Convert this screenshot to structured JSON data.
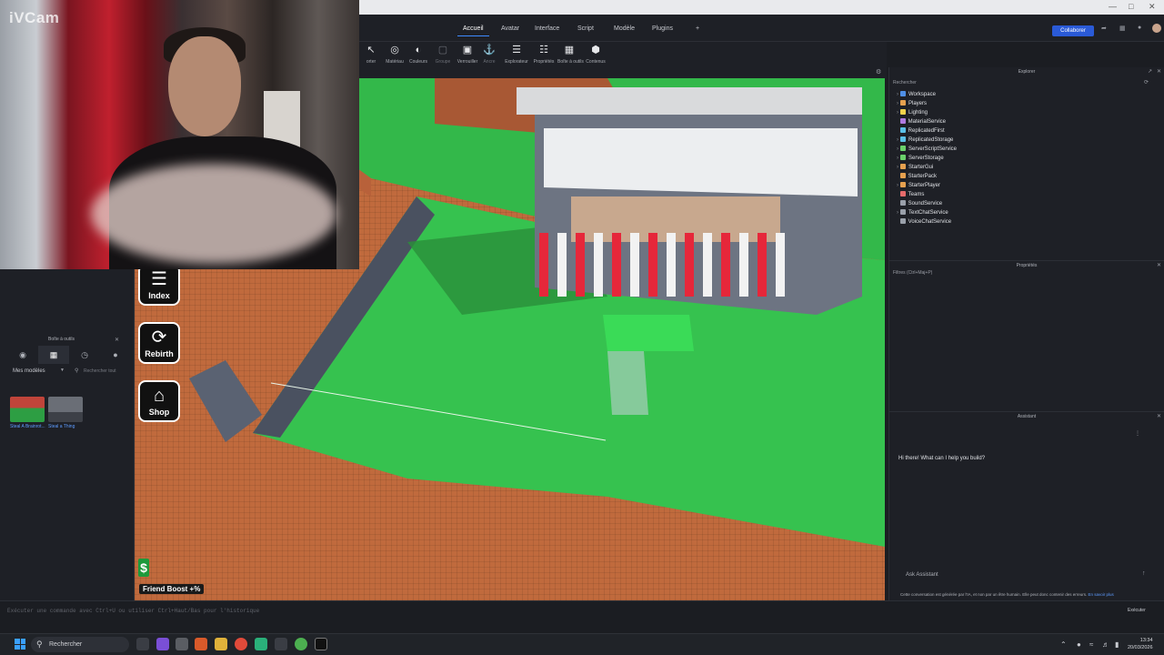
{
  "webcam": {
    "watermark": "iVCam"
  },
  "menu": {
    "tabs": [
      "Accueil",
      "Avatar",
      "Interface",
      "Script",
      "Modèle",
      "Plugins"
    ],
    "active": "Accueil",
    "collaborate": "Collaborer"
  },
  "toolbar": {
    "items": [
      {
        "icon": "mouse",
        "label": "orter",
        "dim": false
      },
      {
        "icon": "material",
        "label": "Matériau",
        "dim": false
      },
      {
        "icon": "color",
        "label": "Couleurs",
        "dim": false
      },
      {
        "icon": "group",
        "label": "Groupe",
        "dim": true
      },
      {
        "icon": "lock",
        "label": "Verrouiller",
        "dim": false
      },
      {
        "icon": "anchor",
        "label": "Ancre",
        "dim": true
      },
      {
        "icon": "explorer",
        "label": "Explorateur",
        "dim": false
      },
      {
        "icon": "properties",
        "label": "Propriétés",
        "dim": false
      },
      {
        "icon": "toolbox",
        "label": "Boîte à outils",
        "dim": false
      },
      {
        "icon": "content",
        "label": "Contenus",
        "dim": false
      }
    ]
  },
  "game_hud": {
    "index_label": "Index",
    "rebirth_label": "Rebirth",
    "shop_label": "Shop",
    "friend_boost": "Friend Boost +%",
    "dollar": "$"
  },
  "toolbox": {
    "title": "Boîte à outils",
    "dropdown": "Mes modèles",
    "search_placeholder": "Rechercher tout",
    "models": [
      {
        "name": "Steal A Brainrot...",
        "color": "#8a3a2e"
      },
      {
        "name": "Steal a Thing",
        "color": "#5a5d63"
      }
    ]
  },
  "explorer": {
    "title": "Explorer",
    "search_placeholder": "Rechercher",
    "items": [
      {
        "name": "Workspace",
        "color": "#4f8fe6",
        "expandable": true
      },
      {
        "name": "Players",
        "color": "#e6a14f",
        "expandable": true
      },
      {
        "name": "Lighting",
        "color": "#f2d24b",
        "expandable": true
      },
      {
        "name": "MaterialService",
        "color": "#b07be0",
        "expandable": false
      },
      {
        "name": "ReplicatedFirst",
        "color": "#5bc0e6",
        "expandable": false
      },
      {
        "name": "ReplicatedStorage",
        "color": "#5bc0e6",
        "expandable": true
      },
      {
        "name": "ServerScriptService",
        "color": "#6bd26b",
        "expandable": true
      },
      {
        "name": "ServerStorage",
        "color": "#6bd26b",
        "expandable": true
      },
      {
        "name": "StarterGui",
        "color": "#e6a14f",
        "expandable": true
      },
      {
        "name": "StarterPack",
        "color": "#e6a14f",
        "expandable": false
      },
      {
        "name": "StarterPlayer",
        "color": "#e6a14f",
        "expandable": true
      },
      {
        "name": "Teams",
        "color": "#e66b6b",
        "expandable": false
      },
      {
        "name": "SoundService",
        "color": "#9aa0aa",
        "expandable": false
      },
      {
        "name": "TextChatService",
        "color": "#9aa0aa",
        "expandable": true
      },
      {
        "name": "VoiceChatService",
        "color": "#9aa0aa",
        "expandable": false
      }
    ]
  },
  "properties": {
    "title": "Propriétés",
    "filter_placeholder": "Filtres (Ctrl+Maj+P)"
  },
  "assistant": {
    "title": "Assistant",
    "greeting": "Hi there! What can I help you build?",
    "input_placeholder": "Ask Assistant",
    "disclaimer": "Cette conversation est générée par l'IA, et non par un être humain. Elle peut donc contenir des erreurs.",
    "disclaimer_link": "En savoir plus"
  },
  "command_bar": {
    "hint": "Exécuter une commande avec Ctrl+U ou utiliser Ctrl+Haut/Bas pour l'historique",
    "run_label": "Exécuter"
  },
  "taskbar": {
    "search": "Rechercher",
    "time": "13:34",
    "date": "20/03/2026"
  }
}
